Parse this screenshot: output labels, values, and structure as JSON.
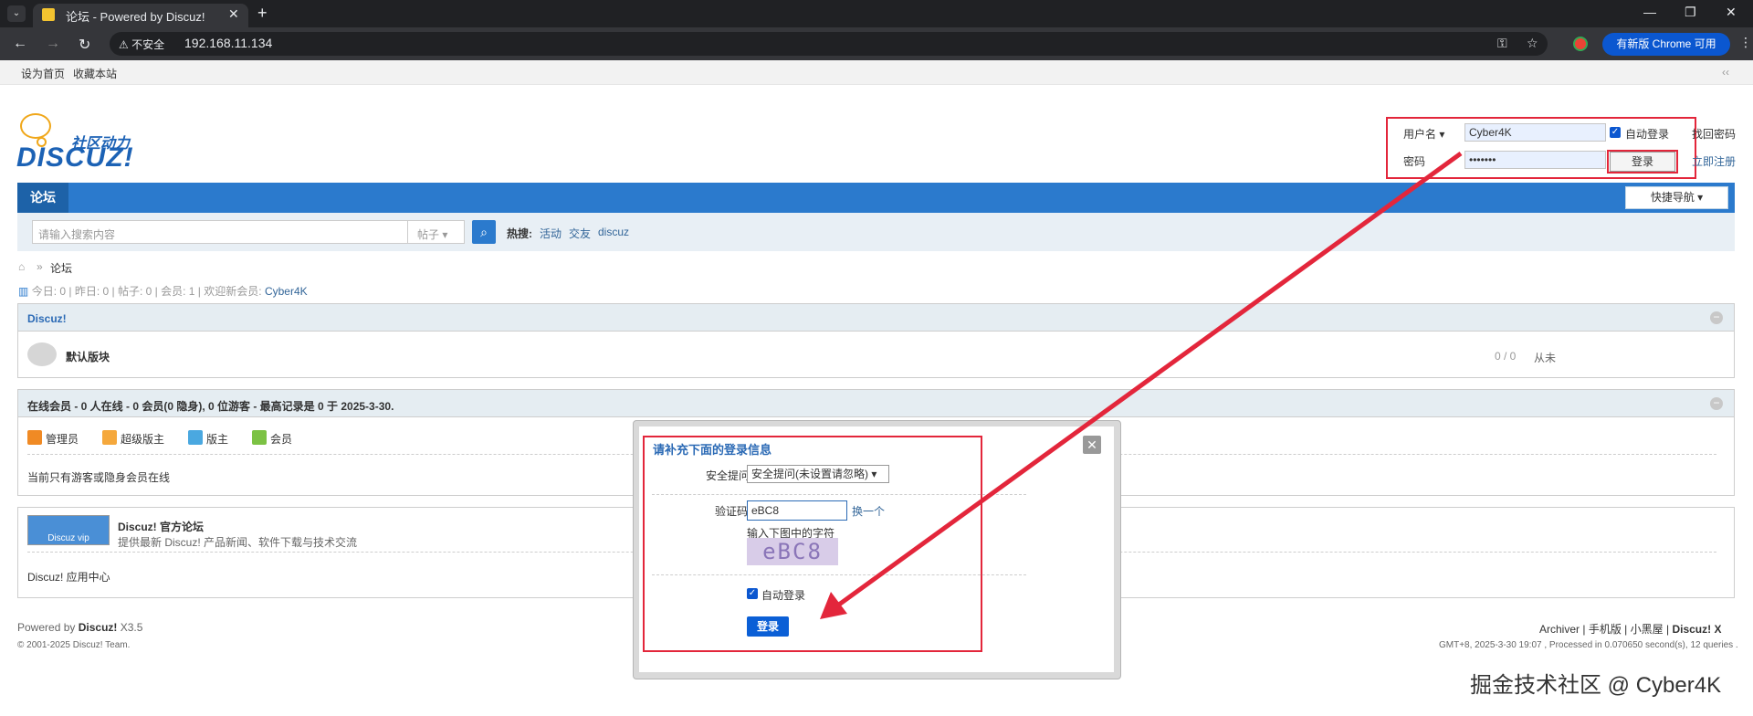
{
  "browser": {
    "tab_title": "论坛 - Powered by Discuz!",
    "insecure_label": "不安全",
    "url": "192.168.11.134",
    "update_button": "有新版 Chrome 可用"
  },
  "toplinks": {
    "set_home": "设为首页",
    "bookmark": "收藏本站",
    "collapse": "‹‹"
  },
  "logo": {
    "subtitle": "社区动力",
    "brand": "DISCUZ!"
  },
  "login": {
    "username_label": "用户名",
    "username_value": "Cyber4K",
    "password_label": "密码",
    "password_value": "•••••••",
    "auto_login": "自动登录",
    "forgot": "找回密码",
    "register": "立即注册",
    "submit": "登录"
  },
  "nav": {
    "forum_tab": "论坛",
    "quick_nav": "快捷导航"
  },
  "search": {
    "placeholder": "请输入搜索内容",
    "type": "帖子",
    "hot_label": "热搜:",
    "hot_terms": [
      "活动",
      "交友",
      "discuz"
    ]
  },
  "breadcrumb": {
    "current": "论坛"
  },
  "stats": {
    "today": "今日: 0",
    "yesterday": "昨日: 0",
    "posts": "帖子: 0",
    "members": "会员: 1",
    "welcome": "欢迎新会员:",
    "newest_member": "Cyber4K"
  },
  "forum_section": {
    "title": "Discuz!",
    "board_name": "默认版块",
    "counts": "0 / 0",
    "last_post": "从未"
  },
  "online_section": {
    "title": "在线会员 - 0 人在线 - 0 会员(0 隐身), 0 位游客 - 最高记录是 0 于 2025-3-30.",
    "legend": [
      "管理员",
      "超级版主",
      "版主",
      "会员"
    ],
    "note": "当前只有游客或隐身会员在线"
  },
  "links_section": {
    "official_name": "Discuz! 官方论坛",
    "official_desc": "提供最新 Discuz! 产品新闻、软件下载与技术交流",
    "app_center": "Discuz! 应用中心",
    "badge": "Discuz vip"
  },
  "footer": {
    "powered": "Powered by",
    "brand": "Discuz!",
    "version": "X3.5",
    "copyright": "© 2001-2025 Discuz! Team.",
    "links": [
      "Archiver",
      "手机版",
      "小黑屋",
      "Discuz! X"
    ],
    "timing": "GMT+8, 2025-3-30 19:07 , Processed in 0.070650 second(s), 12 queries ."
  },
  "dialog": {
    "title": "请补充下面的登录信息",
    "security_label": "安全提问:",
    "security_value": "安全提问(未设置请忽略)",
    "captcha_label": "验证码:",
    "captcha_value": "eBC8",
    "refresh": "换一个",
    "captcha_hint": "输入下图中的字符",
    "captcha_image_text": "eBC8",
    "auto_login": "自动登录",
    "submit": "登录"
  },
  "watermark": "掘金技术社区 @ Cyber4K",
  "colors": {
    "accent": "#2b7acd",
    "annotation_red": "#e3263b",
    "link": "#336699"
  }
}
